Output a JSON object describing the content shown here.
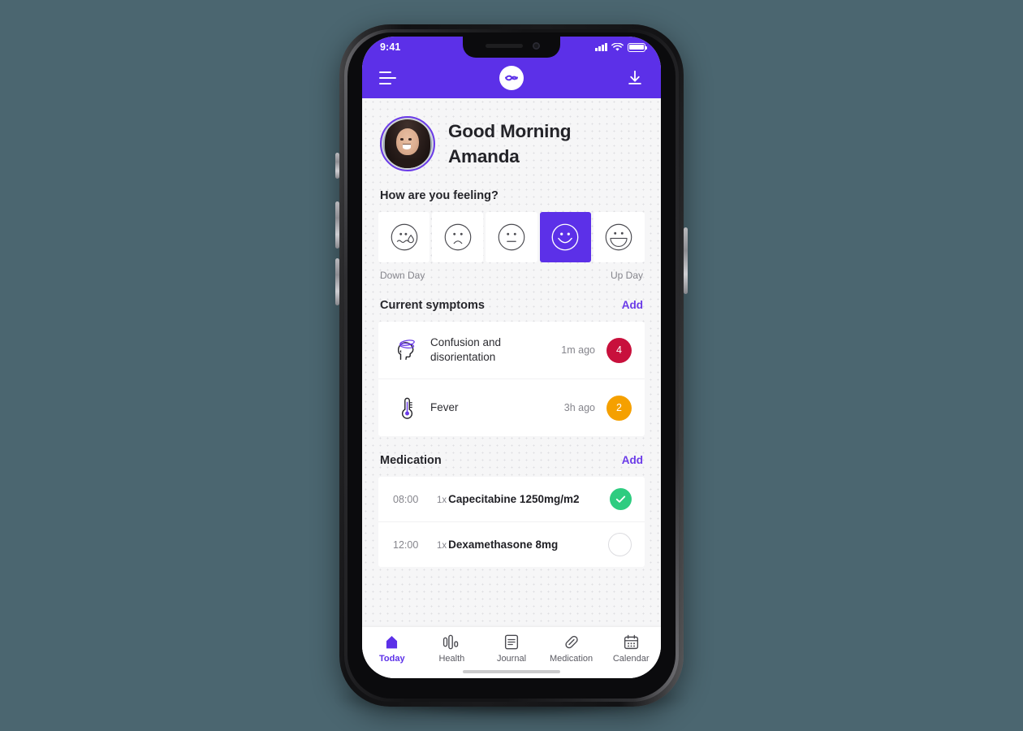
{
  "device": {
    "status_bar": {
      "time": "9:41",
      "signal_icon": "cellular-signal-icon",
      "wifi_icon": "wifi-icon",
      "battery_icon": "battery-full-icon"
    }
  },
  "header": {
    "menu_icon": "hamburger-menu-icon",
    "logo_icon": "app-logo-swirl-icon",
    "download_icon": "download-icon",
    "background_color": "#5C30E8"
  },
  "greeting": {
    "line1": "Good Morning",
    "line2": "Amanda",
    "avatar_icon": "user-avatar-photo"
  },
  "mood": {
    "title": "How are you feeling?",
    "left_caption": "Down Day",
    "right_caption": "Up Day",
    "selected_index": 3,
    "options": [
      {
        "name": "crying-face",
        "label": "Crying"
      },
      {
        "name": "sad-face",
        "label": "Sad"
      },
      {
        "name": "neutral-face",
        "label": "Neutral"
      },
      {
        "name": "smiling-face",
        "label": "Happy"
      },
      {
        "name": "grinning-face",
        "label": "Very Happy"
      }
    ]
  },
  "symptoms": {
    "title": "Current symptoms",
    "add_label": "Add",
    "items": [
      {
        "icon": "dizzy-head-icon",
        "name": "Confusion and disorientation",
        "time": "1m ago",
        "severity": "4",
        "severity_color": "#C8103C"
      },
      {
        "icon": "thermometer-icon",
        "name": "Fever",
        "time": "3h ago",
        "severity": "2",
        "severity_color": "#F5A000"
      }
    ]
  },
  "medication": {
    "title": "Medication",
    "add_label": "Add",
    "items": [
      {
        "time": "08:00",
        "qty": "1x",
        "name": "Capecitabine 1250mg/m2",
        "taken": true,
        "check_color": "#2ECC80"
      },
      {
        "time": "12:00",
        "qty": "1x",
        "name": "Dexamethasone 8mg",
        "taken": false,
        "check_color": "#DCDCE0"
      }
    ]
  },
  "tabbar": {
    "active_index": 0,
    "active_color": "#5C30E8",
    "items": [
      {
        "label": "Today",
        "icon": "home-icon"
      },
      {
        "label": "Health",
        "icon": "bar-chart-icon"
      },
      {
        "label": "Journal",
        "icon": "journal-document-icon"
      },
      {
        "label": "Medication",
        "icon": "pill-capsule-icon"
      },
      {
        "label": "Calendar",
        "icon": "calendar-icon"
      }
    ]
  }
}
